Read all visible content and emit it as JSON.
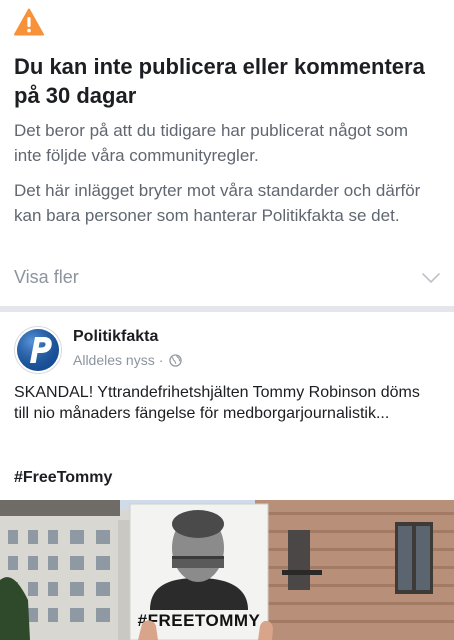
{
  "notice": {
    "title": "Du kan inte publicera eller kommentera på 30 dagar",
    "paragraph1": "Det beror på att du tidigare har publicerat något som inte följde våra communityregler.",
    "paragraph2": "Det här inlägget bryter mot våra standarder och därför kan bara personer som hanterar Politikfakta se det.",
    "show_more_label": "Visa fler",
    "icon": "warning-triangle-icon",
    "accent_color": "#f7923b"
  },
  "post": {
    "page_name": "Politikfakta",
    "timestamp": "Alldeles nyss",
    "separator": "·",
    "audience_icon": "globe-icon",
    "text": "SKANDAL! Yttrandefrihetshjälten Tommy Robinson döms till nio månaders fängelse för medborgarjournalistik...",
    "hashtag": "#FreeTommy",
    "avatar_brand_color": "#1c5aa6",
    "photo": {
      "sign_text": "#FREETOMMY"
    }
  }
}
